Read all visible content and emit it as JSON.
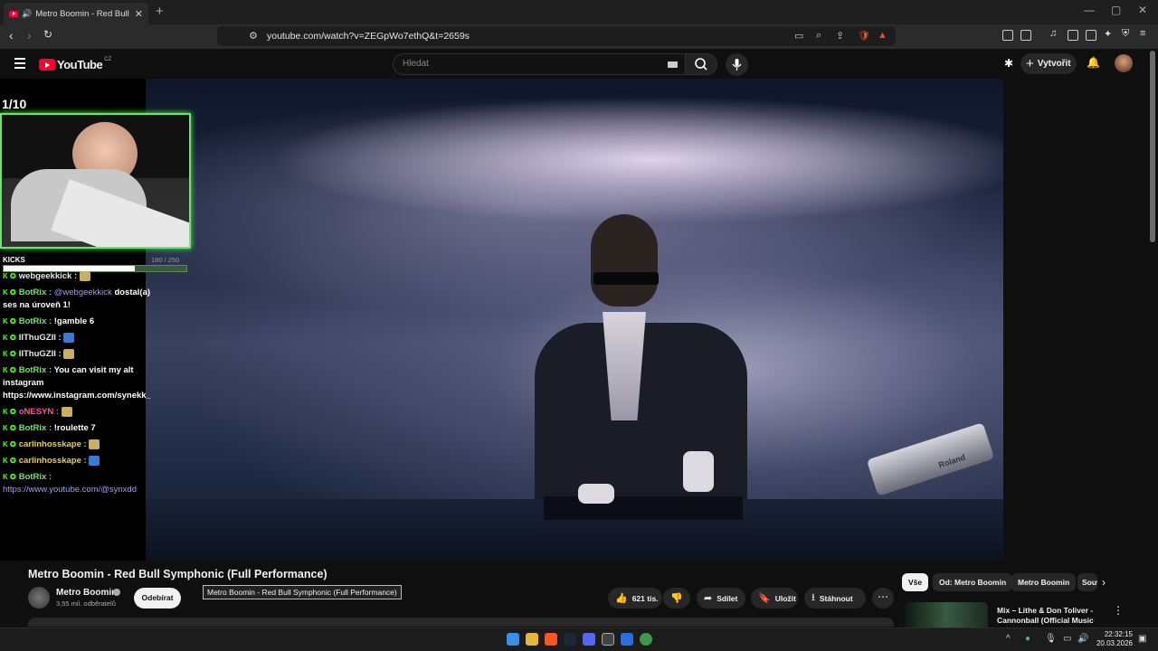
{
  "browser": {
    "tab_title": "Metro Boomin - Red Bull Symphonic (Full Performance)",
    "new_tab": "+",
    "url": "youtube.com/watch?v=ZEGpWo7ethQ&t=2659s",
    "window_controls": [
      "—",
      "▢",
      "✕"
    ]
  },
  "youtube": {
    "logo_text": "YouTube",
    "region": "CZ",
    "search_placeholder": "Hledat",
    "create_label": "Vytvořit"
  },
  "overlay": {
    "counter": "1/10",
    "kicks_label": "KICKS",
    "kicks_progress": "180 / 250",
    "kicks_fraction": 0.72,
    "chat": [
      {
        "user": "webgeekkick :",
        "text": "",
        "style": "user-white"
      },
      {
        "user": "BotRix :",
        "mention": "@webgeekkick",
        "text": "dostal(a) ses na úroveň 1!",
        "style": "user-bot"
      },
      {
        "user": "BotRix :",
        "text": "!gamble 6",
        "style": "user-bot"
      },
      {
        "user": "IIThuGZII :",
        "text": "",
        "style": "user-white"
      },
      {
        "user": "IIThuGZII :",
        "text": "",
        "style": "user-white"
      },
      {
        "user": "BotRix :",
        "text": "You can visit my alt instagram https://www.instagram.com/synekk_",
        "style": "user-bot"
      },
      {
        "user": "oNESYN :",
        "text": "",
        "style": "user-pink"
      },
      {
        "user": "BotRix :",
        "text": "!roulette 7",
        "style": "user-bot"
      },
      {
        "user": "carlinhosskape :",
        "text": "",
        "style": "user-gold"
      },
      {
        "user": "carlinhosskape :",
        "text": "",
        "style": "user-gold"
      },
      {
        "user": "BotRix :",
        "text": "",
        "link": "https://www.youtube.com/@synxdd",
        "style": "user-bot"
      }
    ]
  },
  "video": {
    "title": "Metro Boomin - Red Bull Symphonic (Full Performance)",
    "channel": "Metro Boomin",
    "subscribers": "3,55 mil. odběratelů",
    "subscribe_label": "Odebírat",
    "tooltip": "Metro Boomin - Red Bull Symphonic (Full Performance)",
    "likes": "621 tis.",
    "share_label": "Sdílet",
    "save_label": "Uložit",
    "download_label": "Stáhnout",
    "stage_brand": "Roland"
  },
  "chips": [
    "Vše",
    "Od: Metro Boomin",
    "Metro Boomin",
    "Související"
  ],
  "recommendation": {
    "title": "Mix – Lithe & Don Toliver - Cannonball (Official Music Video)"
  },
  "taskbar": {
    "time": "22:32:15",
    "date": "20.03.2026"
  },
  "colors": {
    "youtube_red": "#ff0033",
    "webcam_border": "#6ee36e",
    "kick_green": "#53fc18"
  }
}
